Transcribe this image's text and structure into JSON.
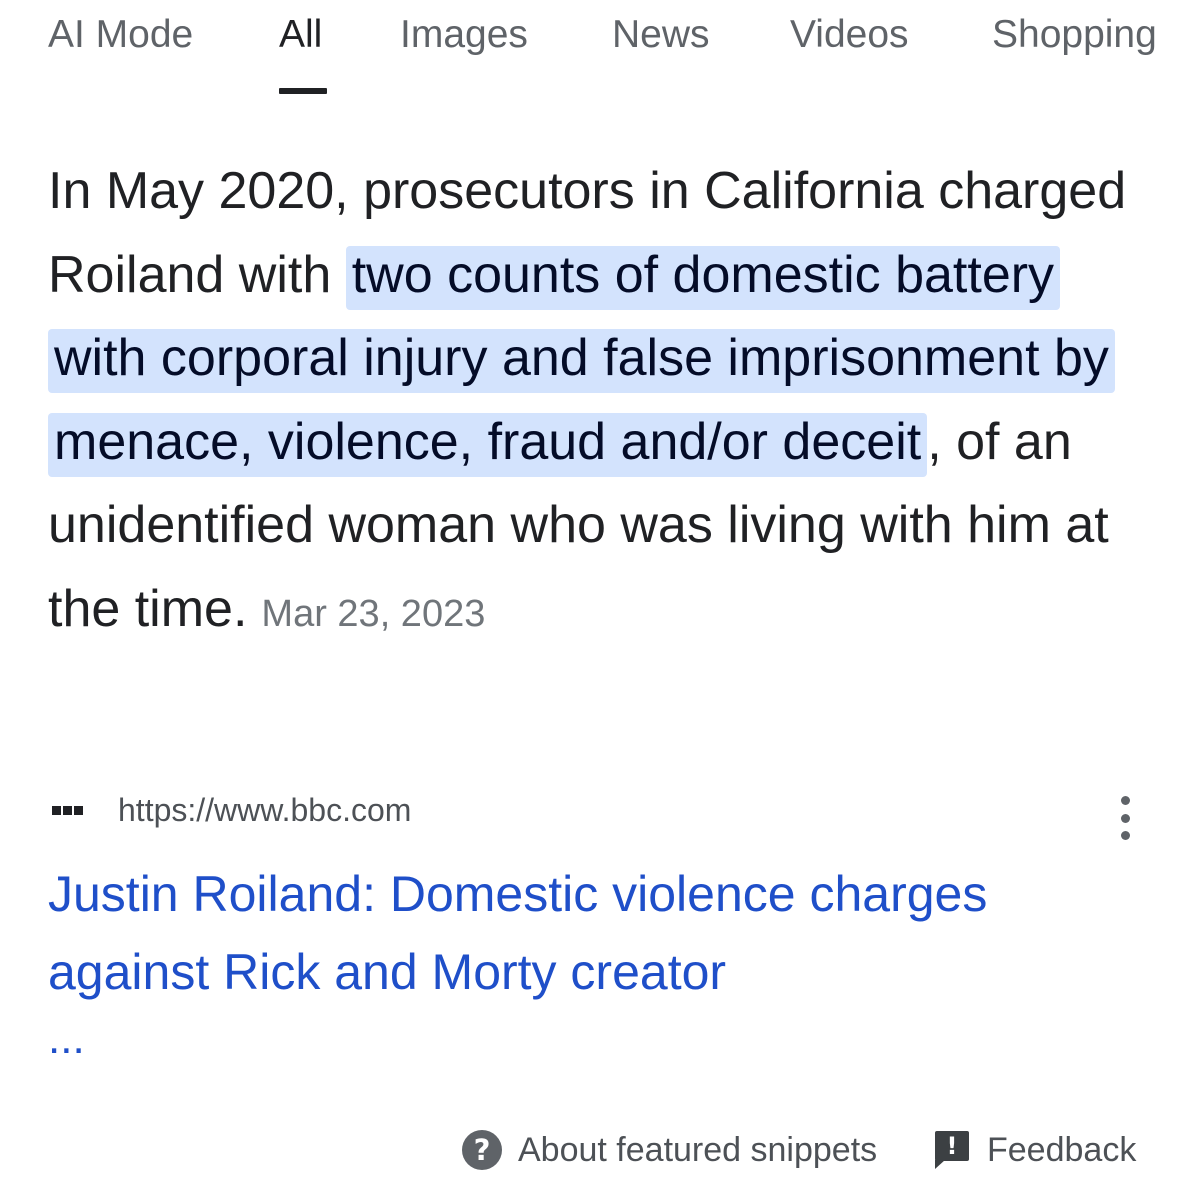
{
  "tabs": {
    "ai_mode": "AI Mode",
    "all": "All",
    "images": "Images",
    "news": "News",
    "videos": "Videos",
    "shopping": "Shopping",
    "active": "All"
  },
  "snippet": {
    "text_before": "In May 2020, prosecutors in California charged Roiland with ",
    "highlight": "two counts of domestic battery with corporal injury and false imprisonment by menace, violence, fraud and/or deceit",
    "text_after": ", of an unidentified woman who was living with him at the time.",
    "date": "Mar 23, 2023"
  },
  "source": {
    "favicon_icon": "bbc-logo-icon",
    "url": "https://www.bbc.com",
    "menu_icon": "more-vert-icon"
  },
  "result": {
    "title": "Justin Roiland: Domestic violence charges against Rick and Morty creator",
    "ellipsis": "...",
    "link_color": "#1f4fc9"
  },
  "footer": {
    "about_icon": "help-icon",
    "about_label": "About featured snippets",
    "feedback_icon": "feedback-icon",
    "feedback_label": "Feedback"
  },
  "colors": {
    "highlight_bg": "#d3e3fd",
    "text": "#202124",
    "muted": "#5f6368"
  }
}
